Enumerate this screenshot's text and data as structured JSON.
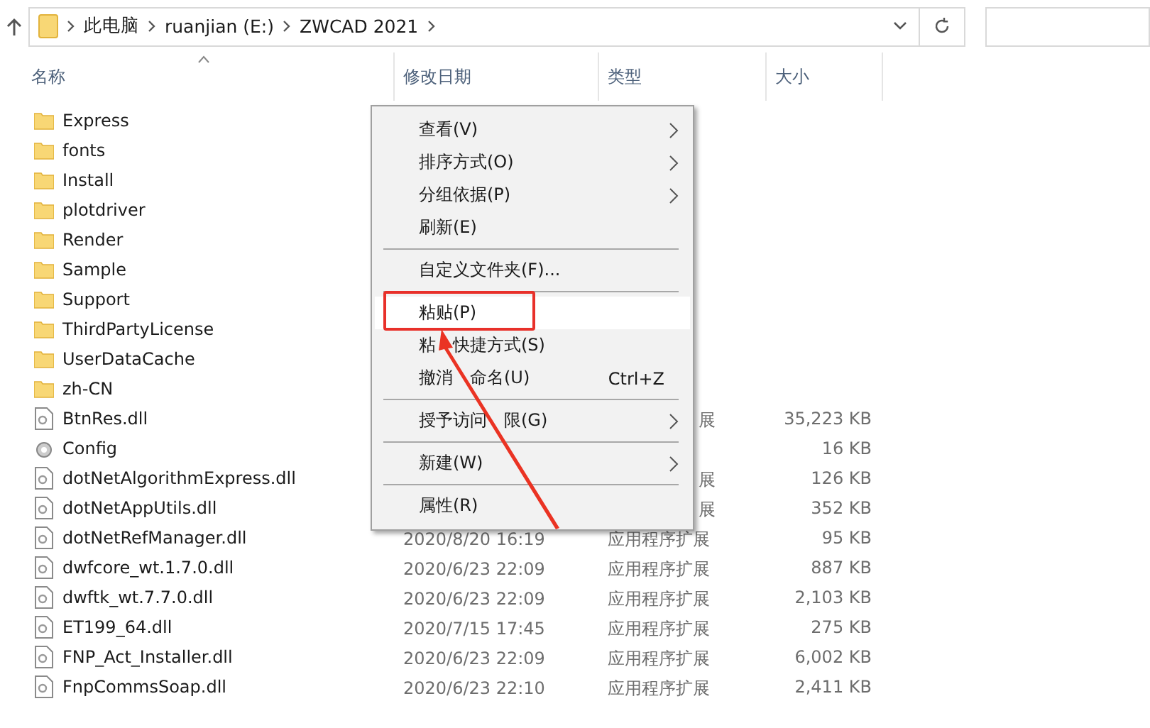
{
  "address_bar": {
    "crumbs": [
      "此电脑",
      "ruanjian (E:)",
      "ZWCAD 2021"
    ]
  },
  "columns": [
    {
      "label": "名称",
      "sorted": true
    },
    {
      "label": "修改日期",
      "sorted": false
    },
    {
      "label": "类型",
      "sorted": false
    },
    {
      "label": "大小",
      "sorted": false
    }
  ],
  "files": [
    {
      "kind": "folder",
      "name": "Express"
    },
    {
      "kind": "folder",
      "name": "fonts"
    },
    {
      "kind": "folder",
      "name": "Install"
    },
    {
      "kind": "folder",
      "name": "plotdriver"
    },
    {
      "kind": "folder",
      "name": "Render"
    },
    {
      "kind": "folder",
      "name": "Sample"
    },
    {
      "kind": "folder",
      "name": "Support"
    },
    {
      "kind": "folder",
      "name": "ThirdPartyLicense"
    },
    {
      "kind": "folder",
      "name": "UserDataCache"
    },
    {
      "kind": "folder",
      "name": "zh-CN"
    },
    {
      "kind": "dll",
      "name": "BtnRes.dll",
      "type": "展",
      "type_cut": true,
      "size": "35,223 KB"
    },
    {
      "kind": "config",
      "name": "Config",
      "size": "16 KB"
    },
    {
      "kind": "dll",
      "name": "dotNetAlgorithmExpress.dll",
      "type": "展",
      "type_cut": true,
      "size": "126 KB"
    },
    {
      "kind": "dll",
      "name": "dotNetAppUtils.dll",
      "type": "展",
      "type_cut": true,
      "size": "352 KB"
    },
    {
      "kind": "dll",
      "name": "dotNetRefManager.dll",
      "date": "2020/8/20 16:19",
      "type": "应用程序扩展",
      "size": "95 KB"
    },
    {
      "kind": "dll",
      "name": "dwfcore_wt.1.7.0.dll",
      "date": "2020/6/23 22:09",
      "type": "应用程序扩展",
      "size": "887 KB"
    },
    {
      "kind": "dll",
      "name": "dwftk_wt.7.7.0.dll",
      "date": "2020/6/23 22:09",
      "type": "应用程序扩展",
      "size": "2,103 KB"
    },
    {
      "kind": "dll",
      "name": "ET199_64.dll",
      "date": "2020/7/15 17:45",
      "type": "应用程序扩展",
      "size": "275 KB"
    },
    {
      "kind": "dll",
      "name": "FNP_Act_Installer.dll",
      "date": "2020/6/23 22:09",
      "type": "应用程序扩展",
      "size": "6,002 KB"
    },
    {
      "kind": "dll",
      "name": "FnpCommsSoap.dll",
      "date": "2020/6/23 22:10",
      "type": "应用程序扩展",
      "size": "2,411 KB"
    }
  ],
  "context_menu": [
    {
      "kind": "item",
      "label": "查看(V)",
      "submenu": true,
      "selected": false
    },
    {
      "kind": "item",
      "label": "排序方式(O)",
      "submenu": true,
      "selected": false
    },
    {
      "kind": "item",
      "label": "分组依据(P)",
      "submenu": true,
      "selected": false
    },
    {
      "kind": "item",
      "label": "刷新(E)",
      "submenu": false,
      "selected": false
    },
    {
      "kind": "separator"
    },
    {
      "kind": "item",
      "label": "自定义文件夹(F)...",
      "submenu": false,
      "selected": false
    },
    {
      "kind": "separator"
    },
    {
      "kind": "item",
      "label": "粘贴(P)",
      "submenu": false,
      "selected": true,
      "annotated": true
    },
    {
      "kind": "item",
      "label_parts": [
        "粘",
        "快捷方式(S)"
      ],
      "submenu": false,
      "selected": false
    },
    {
      "kind": "item",
      "label_parts": [
        "撤消",
        "命名(U)"
      ],
      "shortcut": "Ctrl+Z",
      "submenu": false,
      "selected": false
    },
    {
      "kind": "separator"
    },
    {
      "kind": "item",
      "label_parts": [
        "授予访问",
        "限(G)"
      ],
      "submenu": true,
      "selected": false
    },
    {
      "kind": "separator"
    },
    {
      "kind": "item",
      "label": "新建(W)",
      "submenu": true,
      "selected": false
    },
    {
      "kind": "separator"
    },
    {
      "kind": "item",
      "label": "属性(R)",
      "submenu": false,
      "selected": false
    }
  ]
}
